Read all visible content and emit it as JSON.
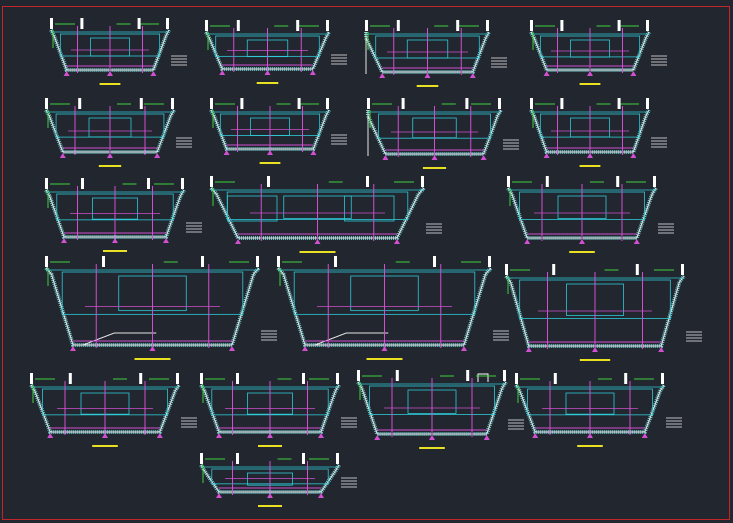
{
  "canvas": {
    "background": "#21262f",
    "border_color": "#c0262a"
  },
  "palette": {
    "outline": "#e6e6e6",
    "concrete_hatch": "#7fe8e8",
    "axis": "#d14fd1",
    "grid": "#2ecad6",
    "level_mark": "#3fd13f",
    "caption_bar": "#e8e020",
    "post": "#ffffff"
  },
  "sections": [
    {
      "id": "s01",
      "variant": "narrow"
    },
    {
      "id": "s02",
      "variant": "narrow"
    },
    {
      "id": "s03",
      "variant": "narrow-openleft"
    },
    {
      "id": "s04",
      "variant": "narrow"
    },
    {
      "id": "s05",
      "variant": "narrow"
    },
    {
      "id": "s06",
      "variant": "narrow"
    },
    {
      "id": "s07",
      "variant": "step-left"
    },
    {
      "id": "s08",
      "variant": "narrow"
    },
    {
      "id": "s09",
      "variant": "medium"
    },
    {
      "id": "s10",
      "variant": "wide-double"
    },
    {
      "id": "s11",
      "variant": "medium"
    },
    {
      "id": "s12",
      "variant": "large-step"
    },
    {
      "id": "s13",
      "variant": "large-step"
    },
    {
      "id": "s14",
      "variant": "large-simple"
    },
    {
      "id": "s15",
      "variant": "medium"
    },
    {
      "id": "s16",
      "variant": "medium"
    },
    {
      "id": "s17",
      "variant": "medium-stair"
    },
    {
      "id": "s18",
      "variant": "medium"
    },
    {
      "id": "s19",
      "variant": "shallow"
    }
  ]
}
